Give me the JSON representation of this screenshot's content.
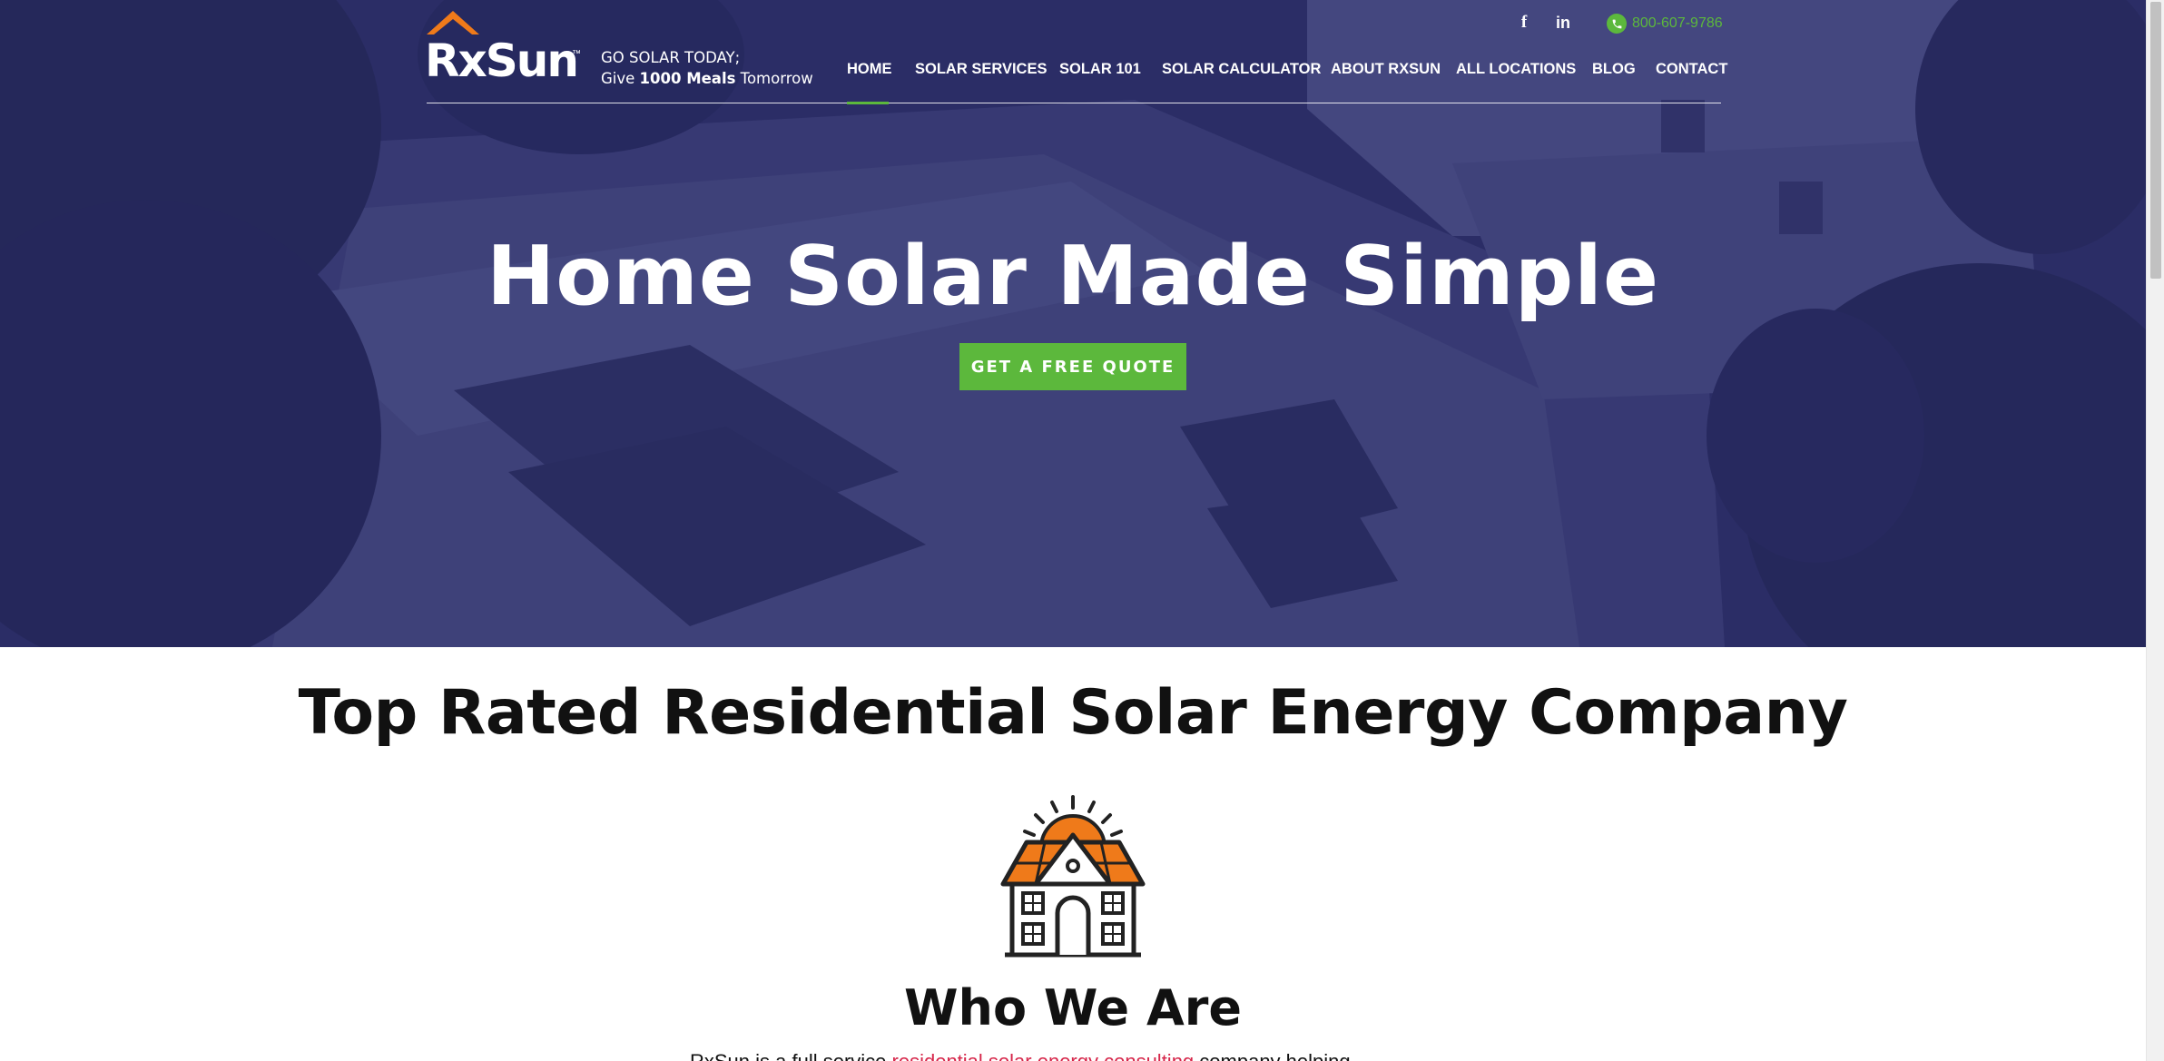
{
  "brand": {
    "logo_text_a": "Rx",
    "logo_text_b": "Sun",
    "trademark": "™",
    "tagline_line1": "GO SOLAR TODAY;",
    "tagline_give": "Give ",
    "tagline_meals": "1000 Meals",
    "tagline_end": " Tomorrow"
  },
  "header": {
    "social": {
      "facebook_icon": "f",
      "linkedin_icon": "in"
    },
    "phone": "800-607-9786"
  },
  "nav": {
    "items": [
      {
        "label": "HOME"
      },
      {
        "label": "SOLAR SERVICES"
      },
      {
        "label": "SOLAR 101"
      },
      {
        "label": "SOLAR CALCULATOR"
      },
      {
        "label": "ABOUT RXSUN"
      },
      {
        "label": "ALL LOCATIONS"
      },
      {
        "label": "BLOG"
      },
      {
        "label": "CONTACT"
      }
    ],
    "active": "HOME"
  },
  "hero": {
    "title": "Home Solar Made Simple",
    "cta_label": "GET A FREE QUOTE"
  },
  "main": {
    "section_title": "Top Rated Residential Solar Energy Company",
    "who_title": "Who We Are",
    "intro_start": "RxSun is a full service ",
    "intro_link": "residential solar energy consulting",
    "intro_end": " company helping"
  },
  "colors": {
    "hero_overlay": "#282a64",
    "accent_green": "#5cb83c",
    "logo_orange": "#ef7a1a",
    "link_red": "#d6264a"
  },
  "icons": [
    "facebook-icon",
    "linkedin-icon",
    "phone-icon",
    "house-sun-icon",
    "logo-roof-icon"
  ]
}
